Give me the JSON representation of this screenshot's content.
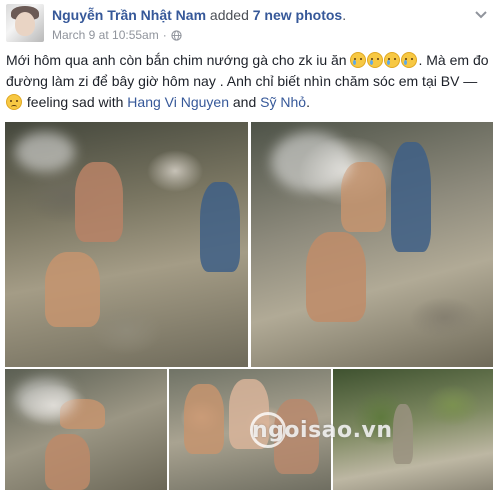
{
  "header": {
    "author_name": "Nguyễn Trần Nhật Nam",
    "action_text": " added ",
    "photos_link": "7 new photos",
    "period": ".",
    "timestamp": "March 9 at 10:55am",
    "separator": "·"
  },
  "post": {
    "text_part1": "Mới hôm qua anh còn bắn chim nướng gà cho zk iu ăn ",
    "text_part2": ". Mà em đo đường làm zi để bây giờ hôm nay . Anh chỉ biết nhìn chăm sóc em tại BV — ",
    "feeling_text": " feeling sad with ",
    "tag1": "Hang Vi Nguyen",
    "and_text": " and ",
    "tag2": "Sỹ Nhỏ",
    "end": "."
  },
  "photos": {
    "watermark": "ngoisao.vn"
  },
  "colors": {
    "link": "#365899",
    "meta": "#90949c",
    "text": "#1d2129"
  },
  "icons": [
    "globe-icon",
    "chevron-down-icon",
    "crying-emoji-icon",
    "sad-emoji-icon"
  ]
}
